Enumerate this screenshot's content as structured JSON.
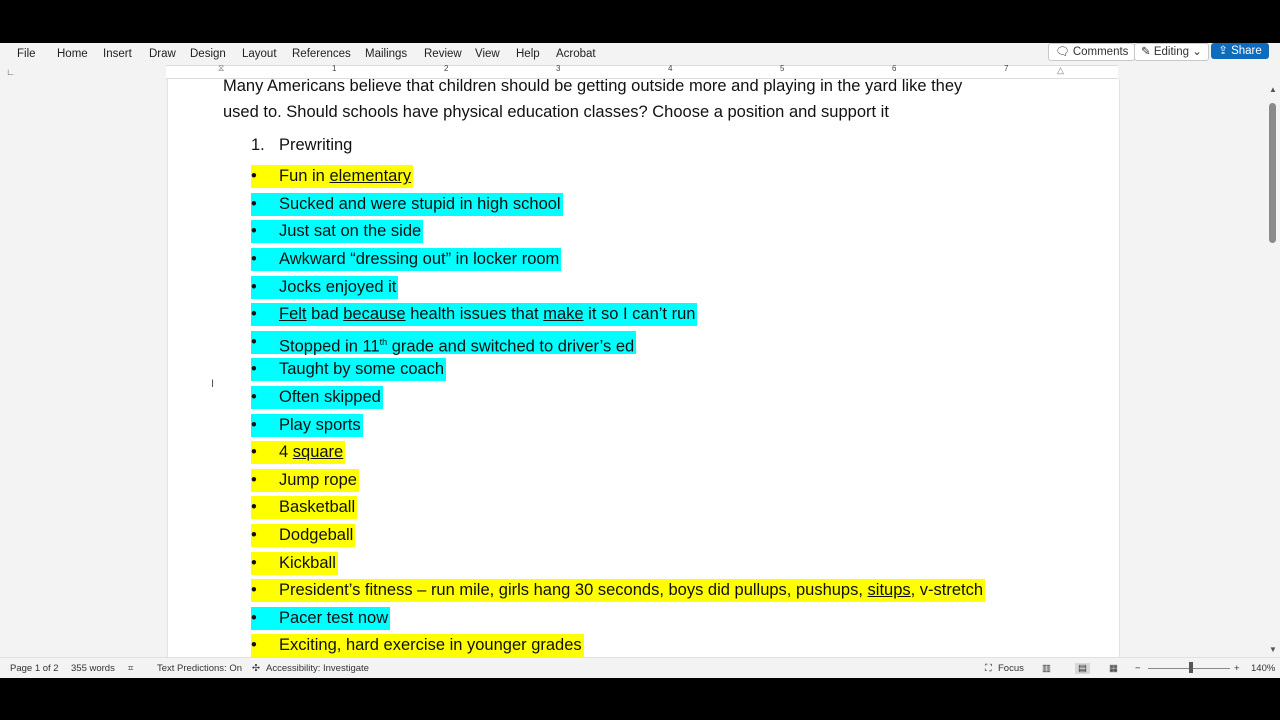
{
  "menu": {
    "items": [
      "File",
      "Home",
      "Insert",
      "Draw",
      "Design",
      "Layout",
      "References",
      "Mailings",
      "Review",
      "View",
      "Help",
      "Acrobat"
    ],
    "comments_label": "Comments",
    "editing_label": "Editing",
    "share_label": "Share"
  },
  "ruler": {
    "numbers": [
      "1",
      "2",
      "3",
      "4",
      "5",
      "6",
      "7"
    ]
  },
  "document": {
    "intro_line1": "Many Americans believe that children should be getting outside more and playing in the yard like they",
    "intro_line2": "used to. Should schools have physical education classes? Choose a position and support it",
    "list_number": "1.",
    "list_title": "Prewriting",
    "bullets": [
      {
        "parts": [
          {
            "t": "Fun in "
          },
          {
            "t": "elementary",
            "u": true
          }
        ],
        "highlight": "yellow"
      },
      {
        "parts": [
          {
            "t": "Sucked and were stupid in high school"
          }
        ],
        "highlight": "cyan"
      },
      {
        "parts": [
          {
            "t": "Just sat on the side"
          }
        ],
        "highlight": "cyan"
      },
      {
        "parts": [
          {
            "t": "Awkward “dressing out” in locker room"
          }
        ],
        "highlight": "cyan"
      },
      {
        "parts": [
          {
            "t": "Jocks enjoyed it"
          }
        ],
        "highlight": "cyan"
      },
      {
        "parts": [
          {
            "t": "Felt",
            "u": true
          },
          {
            "t": " bad "
          },
          {
            "t": "because",
            "u": true
          },
          {
            "t": " health issues that "
          },
          {
            "t": "make",
            "u": true
          },
          {
            "t": " it so I can’t run"
          }
        ],
        "highlight": "cyan"
      },
      {
        "parts": [
          {
            "t": "Stopped in 11"
          },
          {
            "t": "th",
            "sup": true
          },
          {
            "t": " grade and switched to driver’s ed"
          }
        ],
        "highlight": "cyan"
      },
      {
        "parts": [
          {
            "t": "Taught by some coach"
          }
        ],
        "highlight": "cyan"
      },
      {
        "parts": [
          {
            "t": "Often skipped"
          }
        ],
        "highlight": "cyan"
      },
      {
        "parts": [
          {
            "t": "Play sports"
          }
        ],
        "highlight": "cyan"
      },
      {
        "parts": [
          {
            "t": "4 "
          },
          {
            "t": "square",
            "u": true
          }
        ],
        "highlight": "yellow"
      },
      {
        "parts": [
          {
            "t": "Jump rope"
          }
        ],
        "highlight": "yellow"
      },
      {
        "parts": [
          {
            "t": "Basketball"
          }
        ],
        "highlight": "yellow"
      },
      {
        "parts": [
          {
            "t": "Dodgeball"
          }
        ],
        "highlight": "yellow"
      },
      {
        "parts": [
          {
            "t": "Kickball"
          }
        ],
        "highlight": "yellow"
      },
      {
        "parts": [
          {
            "t": "President’s fitness – run mile, girls hang 30 seconds, boys did pullups, pushups, "
          },
          {
            "t": "situps",
            "u": true
          },
          {
            "t": ", v-stretch"
          }
        ],
        "highlight": "yellow"
      },
      {
        "parts": [
          {
            "t": "Pacer test now"
          }
        ],
        "highlight": "cyan"
      },
      {
        "parts": [
          {
            "t": "Exciting, hard exercise in younger grades"
          }
        ],
        "highlight": "yellow"
      }
    ]
  },
  "status": {
    "page": "Page 1 of 2",
    "words": "355 words",
    "text_predictions": "Text Predictions: On",
    "accessibility": "Accessibility: Investigate",
    "focus": "Focus",
    "zoom": "140%"
  },
  "colors": {
    "highlight_yellow": "#ffff00",
    "highlight_cyan": "#00ffff",
    "share_blue": "#0f6cbd"
  }
}
